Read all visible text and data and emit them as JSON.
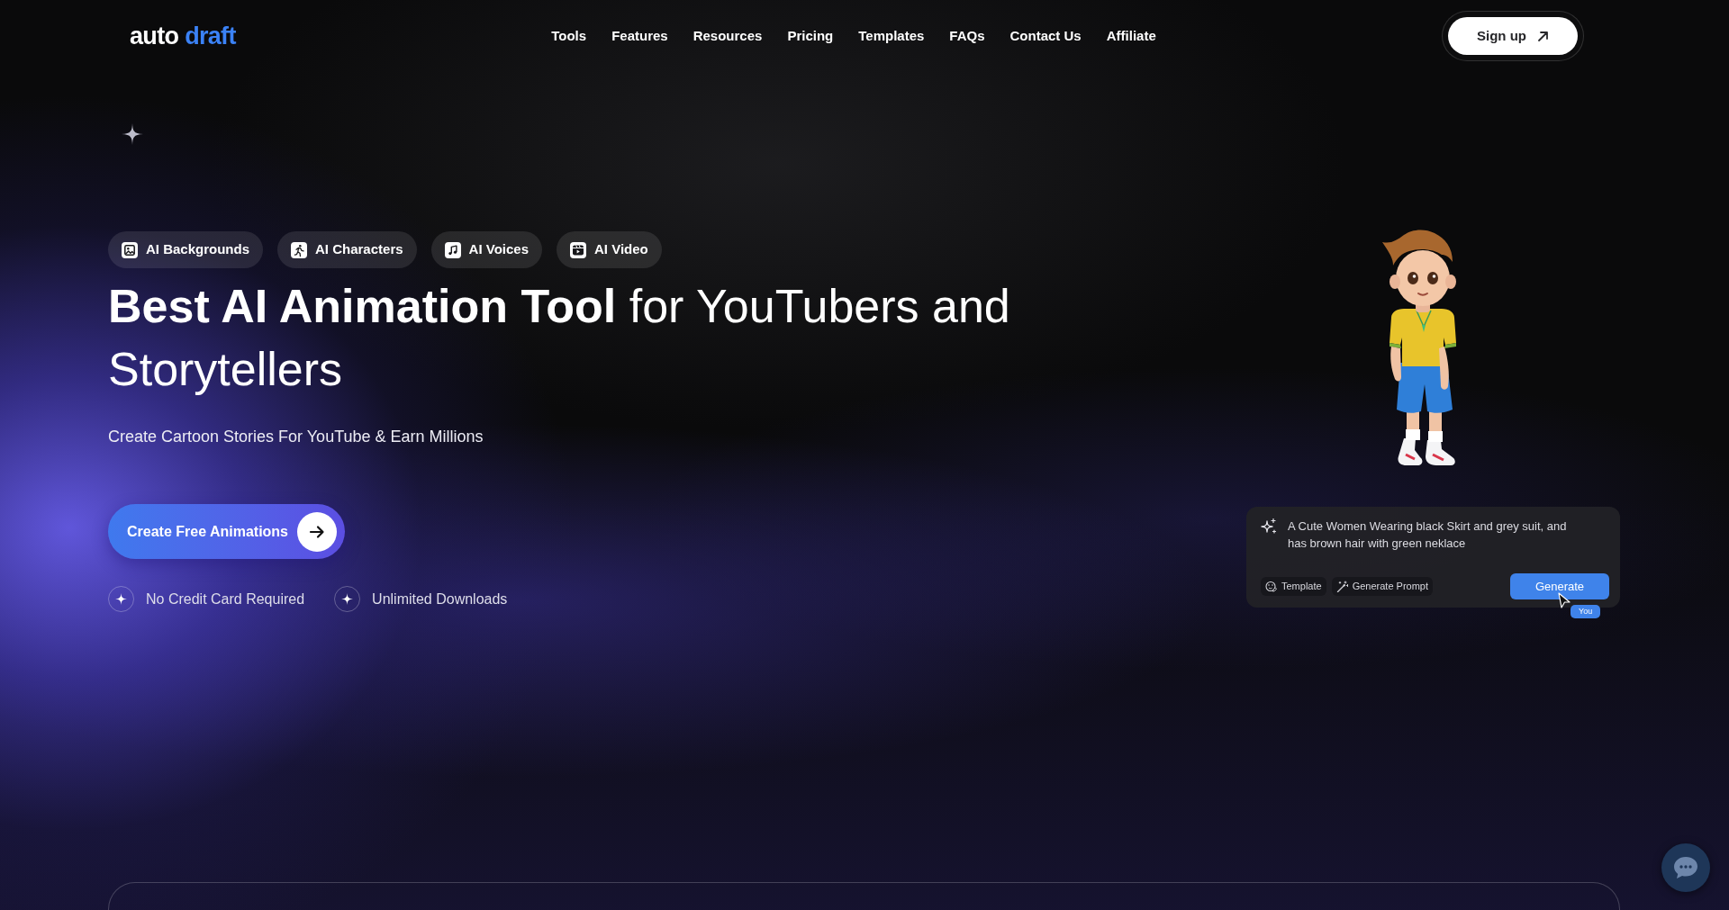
{
  "header": {
    "logo": {
      "first_word": "auto",
      "second_word": "draft"
    },
    "nav": [
      "Tools",
      "Features",
      "Resources",
      "Pricing",
      "Templates",
      "FAQs",
      "Contact Us",
      "Affiliate"
    ],
    "signup_button": "Sign up"
  },
  "hero": {
    "feature_pills": [
      "AI Backgrounds",
      "AI Characters",
      "AI Voices",
      "AI Video"
    ],
    "headline": "**Best AI Animation Tool** for YouTubers and Storytellers",
    "subtitle": "Create Cartoon Stories For YouTube & Earn Millions",
    "cta_button": "Create Free Animations",
    "benefits": [
      "No Credit Card Required",
      "Unlimited Downloads"
    ]
  },
  "prompt_card": {
    "prompt_field": {
      "value": "A Cute Women Wearing black Skirt and grey suit, and has brown hair with green neklace"
    },
    "actions": [
      "Template",
      "Generate Prompt"
    ],
    "generate_button": "Generate",
    "cursor_label": "You"
  }
}
